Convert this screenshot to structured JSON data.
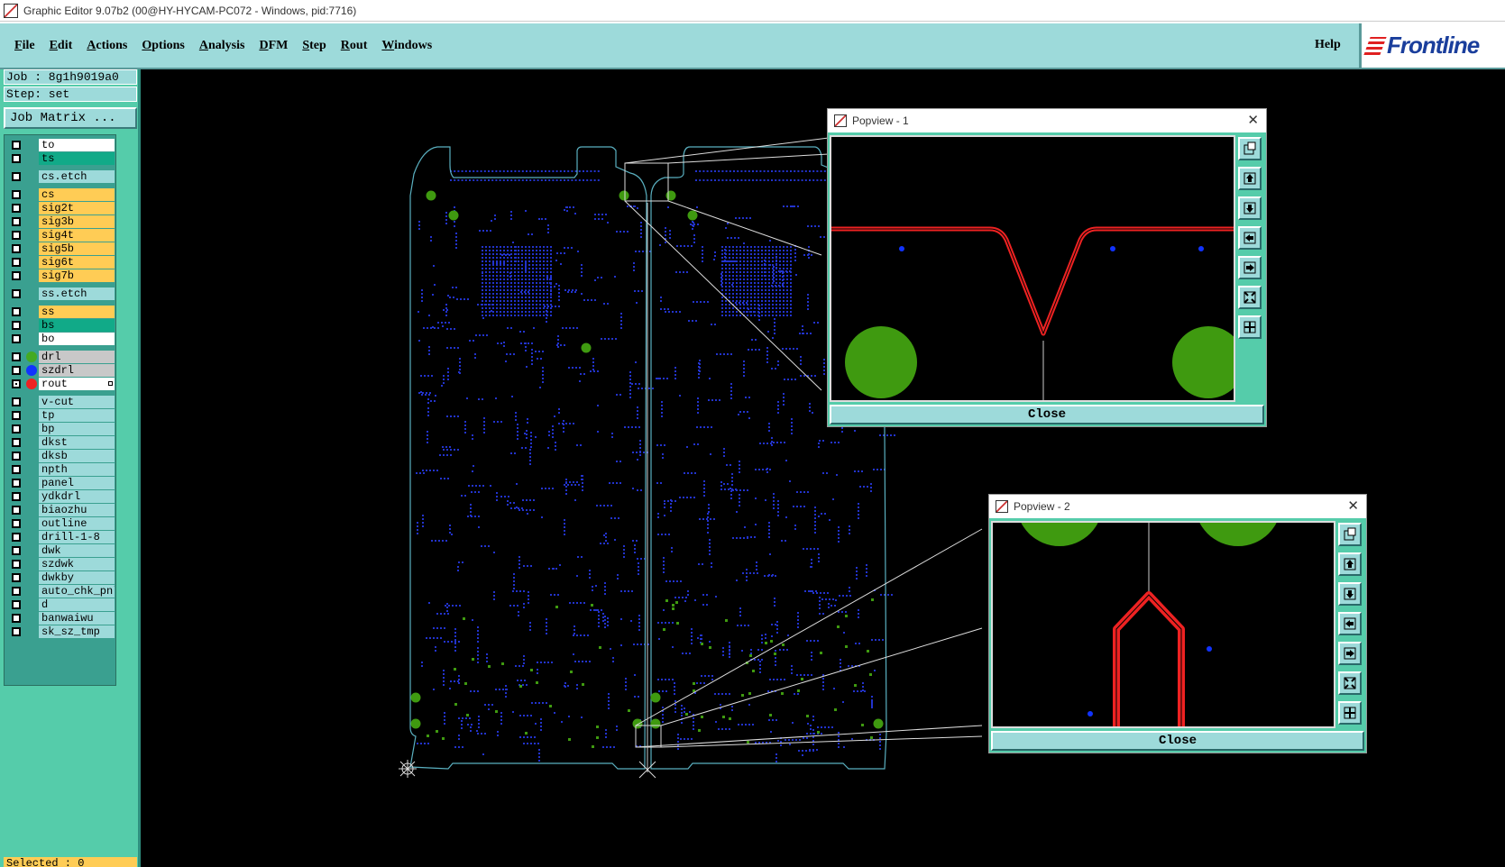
{
  "window": {
    "title": "Graphic Editor 9.07b2 (00@HY-HYCAM-PC072 - Windows, pid:7716)"
  },
  "menu": {
    "items": [
      "File",
      "Edit",
      "Actions",
      "Options",
      "Analysis",
      "DFM",
      "Step",
      "Rout",
      "Windows"
    ],
    "help": "Help",
    "brand": "Frontline"
  },
  "job": {
    "job_label": "Job : 8g1h9019a0",
    "step_label": "Step: set",
    "matrix_button": "Job Matrix ..."
  },
  "layers": [
    {
      "name": "to",
      "color": "white"
    },
    {
      "name": "ts",
      "color": "green"
    },
    {
      "name": "cs.etch",
      "color": "cyan"
    },
    {
      "name": "cs",
      "color": "orange"
    },
    {
      "name": "sig2t",
      "color": "orange"
    },
    {
      "name": "sig3b",
      "color": "orange"
    },
    {
      "name": "sig4t",
      "color": "orange"
    },
    {
      "name": "sig5b",
      "color": "orange"
    },
    {
      "name": "sig6t",
      "color": "orange"
    },
    {
      "name": "sig7b",
      "color": "orange"
    },
    {
      "name": "ss.etch",
      "color": "cyan"
    },
    {
      "name": "ss",
      "color": "orange"
    },
    {
      "name": "bs",
      "color": "green"
    },
    {
      "name": "bo",
      "color": "white"
    },
    {
      "name": "drl",
      "color": "gray",
      "dot": "#44aa22"
    },
    {
      "name": "szdrl",
      "color": "gray",
      "dot": "#1133ff"
    },
    {
      "name": "rout",
      "color": "white",
      "dot": "#ee2222",
      "checked": true
    },
    {
      "name": "v-cut",
      "color": "cyan"
    },
    {
      "name": "tp",
      "color": "cyan"
    },
    {
      "name": "bp",
      "color": "cyan"
    },
    {
      "name": "dkst",
      "color": "cyan"
    },
    {
      "name": "dksb",
      "color": "cyan"
    },
    {
      "name": "npth",
      "color": "cyan"
    },
    {
      "name": "panel",
      "color": "cyan"
    },
    {
      "name": "ydkdrl",
      "color": "cyan"
    },
    {
      "name": "biaozhu",
      "color": "cyan"
    },
    {
      "name": "outline",
      "color": "cyan"
    },
    {
      "name": "drill-1-8",
      "color": "cyan"
    },
    {
      "name": "dwk",
      "color": "cyan"
    },
    {
      "name": "szdwk",
      "color": "cyan"
    },
    {
      "name": "dwkby",
      "color": "cyan"
    },
    {
      "name": "auto_chk_pnl",
      "color": "cyan"
    },
    {
      "name": "d",
      "color": "cyan"
    },
    {
      "name": "banwaiwu",
      "color": "cyan"
    },
    {
      "name": "sk_sz_tmp",
      "color": "cyan"
    }
  ],
  "status": {
    "selected": "Selected : 0"
  },
  "popview1": {
    "title": "Popview - 1",
    "close": "Close"
  },
  "popview2": {
    "title": "Popview - 2",
    "close": "Close"
  },
  "colors": {
    "menu_bg": "#9ddada",
    "panel_bg": "#55ccaa",
    "board_outline": "#5ab0c0",
    "pad": "#3f9a10",
    "via": "#2233cc",
    "rout": "#e01818"
  }
}
